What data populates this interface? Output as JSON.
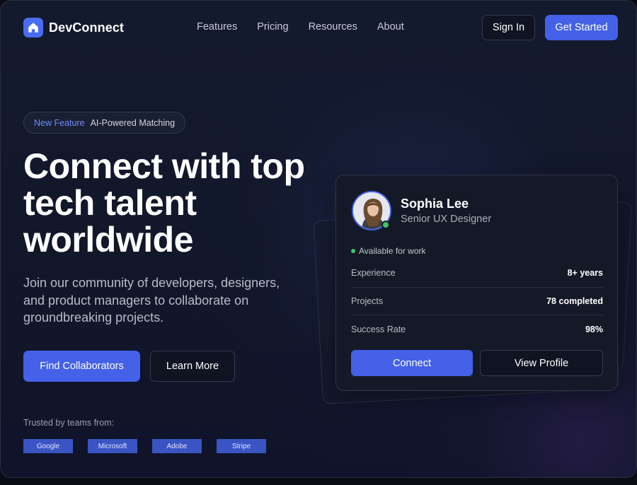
{
  "nav": {
    "brand": "DevConnect",
    "links": [
      "Features",
      "Pricing",
      "Resources",
      "About"
    ],
    "sign_in": "Sign In",
    "get_started": "Get Started"
  },
  "hero": {
    "badge_tag": "New Feature",
    "badge_text": "AI-Powered Matching",
    "headline": "Connect with top tech talent worldwide",
    "subtext": "Join our community of developers, designers, and product managers to collaborate on groundbreaking projects.",
    "primary_button": "Find Collaborators",
    "secondary_button": "Learn More",
    "trusted_label": "Trusted by teams from:",
    "logos": [
      "Google",
      "Microsoft",
      "Adobe",
      "Stripe"
    ]
  },
  "profile_card": {
    "name": "Sophia Lee",
    "role": "Senior UX Designer",
    "availability": "Available for work",
    "stats": [
      {
        "label": "Experience",
        "value": "8+ years"
      },
      {
        "label": "Projects",
        "value": "78 completed"
      },
      {
        "label": "Success Rate",
        "value": "98%"
      }
    ],
    "connect": "Connect",
    "view_profile": "View Profile"
  },
  "colors": {
    "accent": "#4461e8",
    "badge_tag": "#6f8cff",
    "online": "#3fc467",
    "background": "#121729"
  },
  "icons": {
    "brand": "home-icon",
    "avatar": "user-avatar"
  }
}
